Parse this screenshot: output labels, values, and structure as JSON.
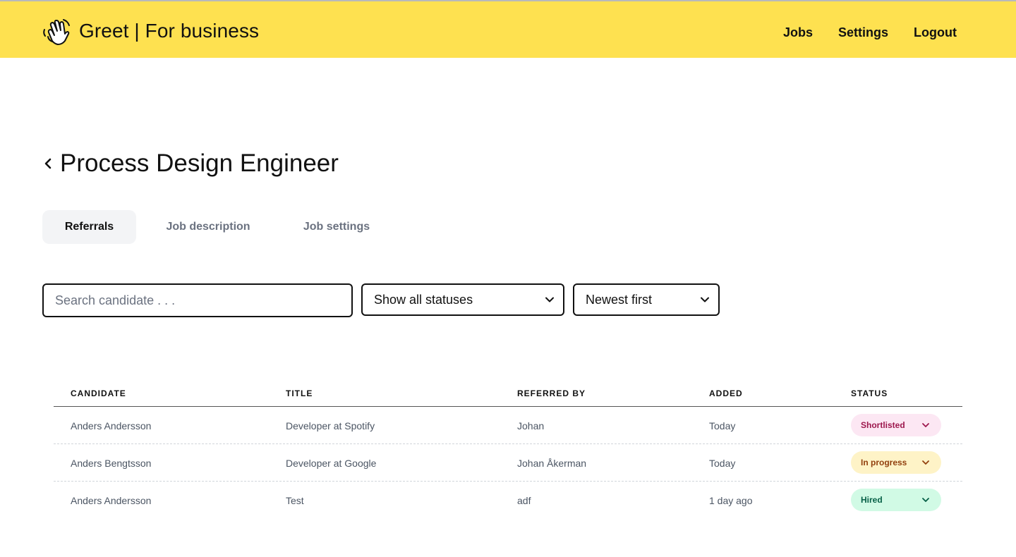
{
  "app": {
    "brand": "Greet | For business",
    "nav": [
      {
        "label": "Jobs"
      },
      {
        "label": "Settings"
      },
      {
        "label": "Logout"
      }
    ]
  },
  "page": {
    "title": "Process Design Engineer"
  },
  "tabs": [
    {
      "label": "Referrals",
      "active": true
    },
    {
      "label": "Job description",
      "active": false
    },
    {
      "label": "Job settings",
      "active": false
    }
  ],
  "filters": {
    "search_placeholder": "Search candidate . . .",
    "status_filter": "Show all statuses",
    "sort": "Newest first"
  },
  "table": {
    "headers": [
      "CANDIDATE",
      "TITLE",
      "REFERRED BY",
      "ADDED",
      "STATUS"
    ],
    "rows": [
      {
        "candidate": "Anders Andersson",
        "title": "Developer at Spotify",
        "referred_by": "Johan",
        "added": "Today",
        "status": "Shortlisted"
      },
      {
        "candidate": "Anders Bengtsson",
        "title": "Developer at Google",
        "referred_by": "Johan Åkerman",
        "added": "Today",
        "status": "In progress"
      },
      {
        "candidate": "Anders Andersson",
        "title": "Test",
        "referred_by": "adf",
        "added": "1 day ago",
        "status": "Hired"
      }
    ]
  },
  "colors": {
    "header_bg": "#fee150",
    "shortlisted_bg": "#fce7f3",
    "in_progress_bg": "#fef3c7",
    "hired_bg": "#d1fae5"
  },
  "icons": {
    "logo": "waving-hand-icon",
    "back": "chevron-left-icon",
    "dropdown": "chevron-down-icon"
  }
}
